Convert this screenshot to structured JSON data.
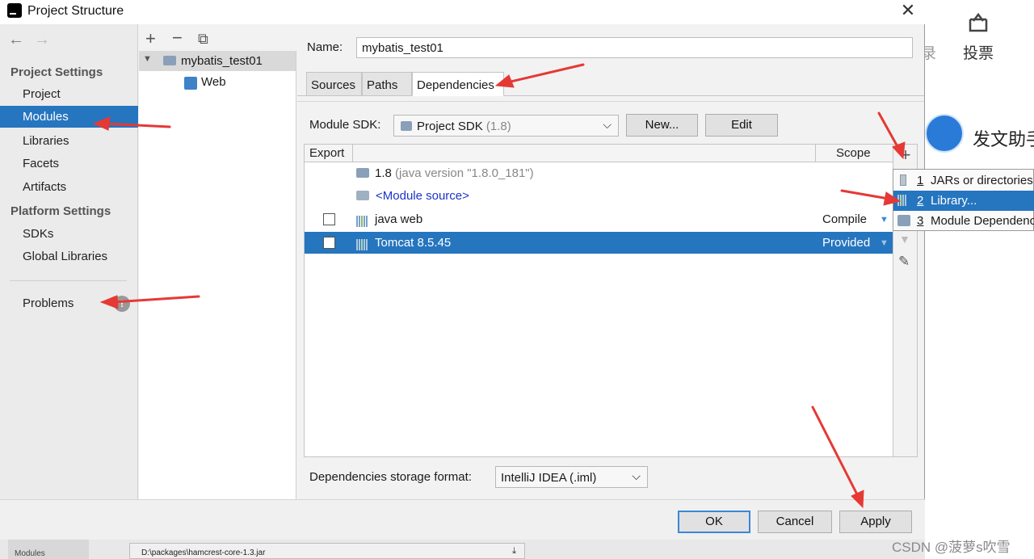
{
  "background": {
    "vote_label": "投票",
    "cut_char": "录",
    "assistant_label": "发文助手",
    "mini_sidebar_label": "Modules",
    "path_text": "D:\\packages\\hamcrest-core-1.3.jar",
    "watermark": "CSDN @菠萝s吹雪"
  },
  "window": {
    "title": "Project Structure",
    "close": "✕"
  },
  "nav": {
    "back": "←",
    "forward": "→",
    "project_settings": "Project Settings",
    "items": [
      "Project",
      "Modules",
      "Libraries",
      "Facets",
      "Artifacts"
    ],
    "platform_settings": "Platform Settings",
    "platform_items": [
      "SDKs",
      "Global Libraries"
    ],
    "problems": "Problems",
    "problems_badge": "!"
  },
  "tree": {
    "add": "+",
    "remove": "−",
    "copy": "⧉",
    "module": "mybatis_test01",
    "facet": "Web"
  },
  "module": {
    "name_label": "Name:",
    "name_value": "mybatis_test01",
    "tabs": [
      "Sources",
      "Paths",
      "Dependencies"
    ],
    "sdk_label": "Module SDK:",
    "sdk_value": "Project SDK",
    "sdk_version": "(1.8)",
    "new_button": "New...",
    "edit_button": "Edit"
  },
  "deps": {
    "col_export": "Export",
    "col_scope": "Scope",
    "rows": [
      {
        "name": "1.8",
        "detail": "(java version \"1.8.0_181\")",
        "scope": ""
      },
      {
        "name": "<Module source>",
        "detail": "",
        "scope": ""
      },
      {
        "name": "java web",
        "detail": "",
        "scope": "Compile"
      },
      {
        "name": "Tomcat 8.5.45",
        "detail": "",
        "scope": "Provided"
      }
    ],
    "storage_label": "Dependencies storage format:",
    "storage_value": "IntelliJ IDEA (.iml)"
  },
  "add_menu": {
    "items": [
      {
        "num": "1",
        "label": "JARs or directories..."
      },
      {
        "num": "2",
        "label": "Library..."
      },
      {
        "num": "3",
        "label": "Module Dependency..."
      }
    ]
  },
  "buttons": {
    "ok": "OK",
    "cancel": "Cancel",
    "apply": "Apply"
  },
  "colors": {
    "selection": "#2675bf",
    "annotation_arrow": "#e53935"
  }
}
